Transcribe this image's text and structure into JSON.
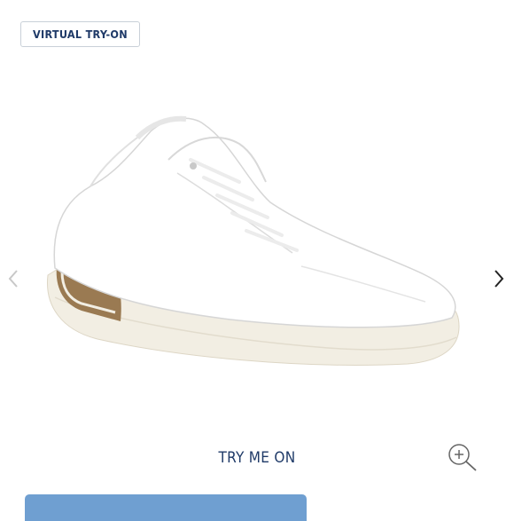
{
  "header": {
    "virtual_tryon_label": "VIRTUAL TRY-ON"
  },
  "carousel": {
    "prev_icon": "chevron-left-icon",
    "next_icon": "chevron-right-icon"
  },
  "product": {
    "image_label": "white leather low-top sneaker"
  },
  "footer": {
    "try_me_on_label": "TRY ME ON",
    "zoom_icon": "zoom-in-icon"
  },
  "colors": {
    "brand_navy": "#1f3a68",
    "bar_blue": "#6f9fd1",
    "sole_cream": "#f2eee3"
  }
}
